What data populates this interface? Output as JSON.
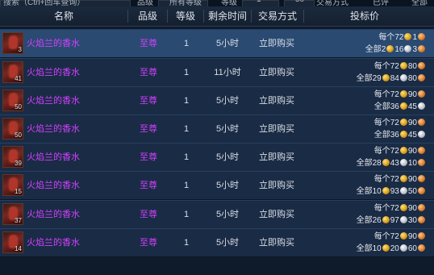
{
  "top_bar": {
    "search_fragment": "搜索（Ctrl+回车查询）",
    "grade_fragment": "品级",
    "grade_select": "所有等级",
    "level_fragment": "等级",
    "level_min": "1",
    "level_max": "50",
    "trade_fragment": "交易方式",
    "all_fragment": "已评",
    "tail_fragment": "全部"
  },
  "columns": {
    "name": "名称",
    "grade": "品级",
    "level": "等级",
    "time": "剩余时间",
    "trade": "交易方式",
    "price": "投标价"
  },
  "colors": {
    "name_text": "#d040ff",
    "row_bg": "#1a2b45",
    "row_selected_bg": "#2a4a72",
    "header_bg": "#14202f"
  },
  "rows": [
    {
      "count": "3",
      "name": "火焰兰的香水",
      "grade": "至尊",
      "level": "1",
      "time": "5小时",
      "trade": "立即购买",
      "each_label": "每个",
      "each_gold": "72",
      "each_silver": "1",
      "each_copper": "",
      "total_label": "全部",
      "total_gold": "2",
      "total_silver": "16",
      "total_copper": "3"
    },
    {
      "count": "41",
      "name": "火焰兰的香水",
      "grade": "至尊",
      "level": "1",
      "time": "11小时",
      "trade": "立即购买",
      "each_label": "每个",
      "each_gold": "72",
      "each_silver": "80",
      "each_copper": "",
      "total_label": "全部",
      "total_gold": "29",
      "total_silver": "84",
      "total_copper": "80"
    },
    {
      "count": "50",
      "name": "火焰兰的香水",
      "grade": "至尊",
      "level": "1",
      "time": "5小时",
      "trade": "立即购买",
      "each_label": "每个",
      "each_gold": "72",
      "each_silver": "90",
      "each_copper": "",
      "total_label": "全部",
      "total_gold": "36",
      "total_silver": "45",
      "total_copper": ""
    },
    {
      "count": "50",
      "name": "火焰兰的香水",
      "grade": "至尊",
      "level": "1",
      "time": "5小时",
      "trade": "立即购买",
      "each_label": "每个",
      "each_gold": "72",
      "each_silver": "90",
      "each_copper": "",
      "total_label": "全部",
      "total_gold": "36",
      "total_silver": "45",
      "total_copper": ""
    },
    {
      "count": "39",
      "name": "火焰兰的香水",
      "grade": "至尊",
      "level": "1",
      "time": "5小时",
      "trade": "立即购买",
      "each_label": "每个",
      "each_gold": "72",
      "each_silver": "90",
      "each_copper": "",
      "total_label": "全部",
      "total_gold": "28",
      "total_silver": "43",
      "total_copper": "10"
    },
    {
      "count": "15",
      "name": "火焰兰的香水",
      "grade": "至尊",
      "level": "1",
      "time": "5小时",
      "trade": "立即购买",
      "each_label": "每个",
      "each_gold": "72",
      "each_silver": "90",
      "each_copper": "",
      "total_label": "全部",
      "total_gold": "10",
      "total_silver": "93",
      "total_copper": "50"
    },
    {
      "count": "37",
      "name": "火焰兰的香水",
      "grade": "至尊",
      "level": "1",
      "time": "5小时",
      "trade": "立即购买",
      "each_label": "每个",
      "each_gold": "72",
      "each_silver": "90",
      "each_copper": "",
      "total_label": "全部",
      "total_gold": "26",
      "total_silver": "97",
      "total_copper": "30"
    },
    {
      "count": "14",
      "name": "火焰兰的香水",
      "grade": "至尊",
      "level": "1",
      "time": "5小时",
      "trade": "立即购买",
      "each_label": "每个",
      "each_gold": "72",
      "each_silver": "90",
      "each_copper": "",
      "total_label": "全部",
      "total_gold": "10",
      "total_silver": "20",
      "total_copper": "60"
    }
  ]
}
